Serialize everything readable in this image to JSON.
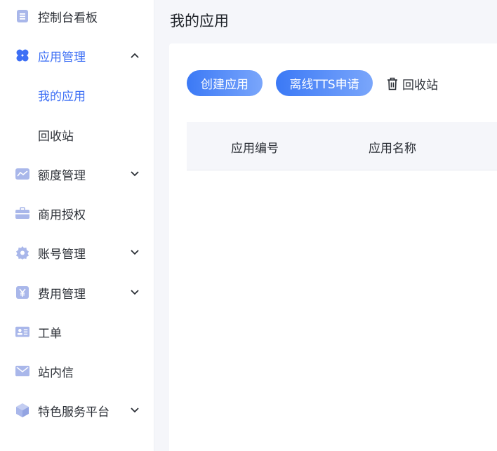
{
  "sidebar": {
    "items": [
      {
        "label": "控制台看板",
        "icon": "dashboard-icon"
      },
      {
        "label": "应用管理",
        "icon": "apps-icon",
        "expanded": true
      },
      {
        "label": "我的应用"
      },
      {
        "label": "回收站"
      },
      {
        "label": "额度管理",
        "icon": "quota-chart-icon"
      },
      {
        "label": "商用授权",
        "icon": "briefcase-icon"
      },
      {
        "label": "账号管理",
        "icon": "gear-icon"
      },
      {
        "label": "费用管理",
        "icon": "yen-icon"
      },
      {
        "label": "工单",
        "icon": "ticket-card-icon"
      },
      {
        "label": "站内信",
        "icon": "mail-icon"
      },
      {
        "label": "特色服务平台",
        "icon": "cube-icon"
      }
    ]
  },
  "main": {
    "title": "我的应用",
    "buttons": {
      "create": "创建应用",
      "offline_tts": "离线TTS申请",
      "recycle": "回收站"
    },
    "table": {
      "columns": [
        "应用编号",
        "应用名称"
      ]
    }
  },
  "colors": {
    "accent": "#3d6ff5",
    "icon": "#a9b7ea",
    "button_gradient_start": "#3b79f6",
    "button_gradient_end": "#7aa6fb"
  }
}
